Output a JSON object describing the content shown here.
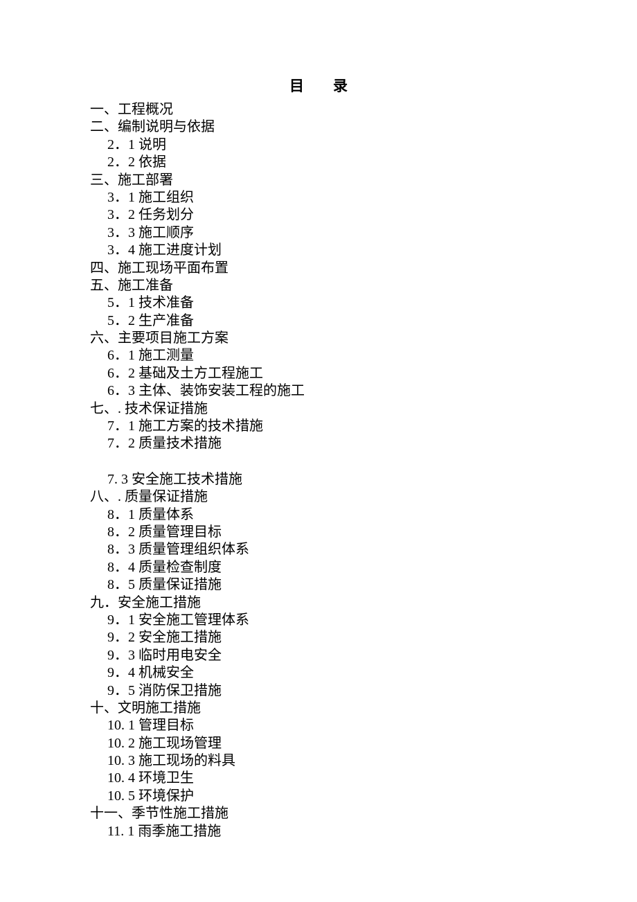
{
  "title_char1": "目",
  "title_char2": "录",
  "toc": [
    {
      "level": 1,
      "text": "一、工程概况"
    },
    {
      "level": 1,
      "text": "二、编制说明与依据"
    },
    {
      "level": 2,
      "text": "2．1 说明"
    },
    {
      "level": 2,
      "text": "2．2 依据"
    },
    {
      "level": 1,
      "text": "三、施工部署"
    },
    {
      "level": 2,
      "text": "3．1 施工组织"
    },
    {
      "level": 2,
      "text": "3．2 任务划分"
    },
    {
      "level": 2,
      "text": "3．3 施工顺序"
    },
    {
      "level": 2,
      "text": "3．4 施工进度计划"
    },
    {
      "level": 1,
      "text": "四、施工现场平面布置"
    },
    {
      "level": 1,
      "text": "五、施工准备"
    },
    {
      "level": 2,
      "text": "5．1 技术准备"
    },
    {
      "level": 2,
      "text": "5．2 生产准备"
    },
    {
      "level": 1,
      "text": "六、主要项目施工方案"
    },
    {
      "level": 2,
      "text": "6．1 施工测量"
    },
    {
      "level": 2,
      "text": "6．2 基础及土方工程施工"
    },
    {
      "level": 2,
      "text": "6．3 主体、装饰安装工程的施工"
    },
    {
      "level": 1,
      "text": "七、. 技术保证措施"
    },
    {
      "level": 2,
      "text": "7．1 施工方案的技术措施"
    },
    {
      "level": 2,
      "text": "7．2 质量技术措施"
    },
    {
      "level": "gap"
    },
    {
      "level": 2,
      "text": "7. 3 安全施工技术措施"
    },
    {
      "level": 1,
      "text": "八、. 质量保证措施"
    },
    {
      "level": 2,
      "text": "8．1 质量体系"
    },
    {
      "level": 2,
      "text": "8．2 质量管理目标"
    },
    {
      "level": 2,
      "text": "8．3 质量管理组织体系"
    },
    {
      "level": 2,
      "text": "8．4 质量检查制度"
    },
    {
      "level": 2,
      "text": "8．5 质量保证措施"
    },
    {
      "level": 1,
      "text": "九．安全施工措施"
    },
    {
      "level": 2,
      "text": "9．1 安全施工管理体系"
    },
    {
      "level": 2,
      "text": "9．2 安全施工措施"
    },
    {
      "level": 2,
      "text": "9．3 临时用电安全"
    },
    {
      "level": 2,
      "text": "9．4 机械安全"
    },
    {
      "level": 2,
      "text": "9．5 消防保卫措施"
    },
    {
      "level": 1,
      "text": "十、文明施工措施"
    },
    {
      "level": 2,
      "text": "10. 1 管理目标"
    },
    {
      "level": 2,
      "text": "10. 2 施工现场管理"
    },
    {
      "level": 2,
      "text": "10. 3 施工现场的料具"
    },
    {
      "level": 2,
      "text": "10. 4 环境卫生"
    },
    {
      "level": 2,
      "text": "10. 5 环境保护"
    },
    {
      "level": 1,
      "text": "十一、季节性施工措施"
    },
    {
      "level": 2,
      "text": "11. 1 雨季施工措施"
    }
  ]
}
